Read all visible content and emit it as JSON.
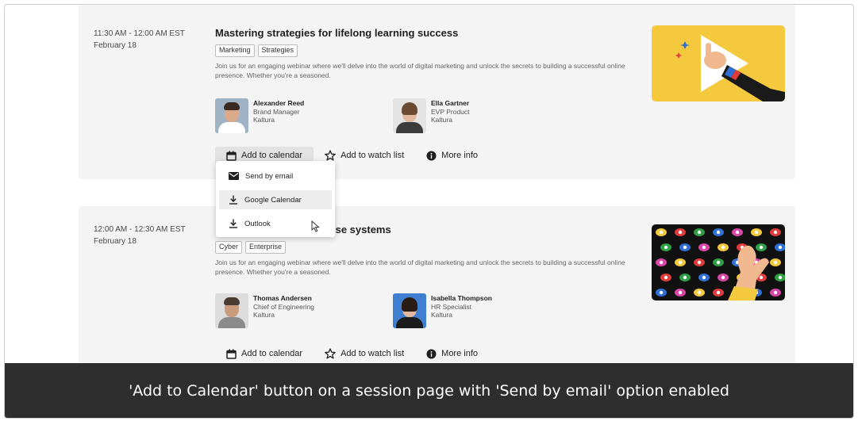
{
  "sessions": [
    {
      "time_range": "11:30 AM - 12:00 AM EST",
      "date": "February 18",
      "title": "Mastering strategies for lifelong learning success",
      "tags": [
        "Marketing",
        "Strategies"
      ],
      "description": "Join us for an engaging webinar where we'll delve into the world of digital marketing and unlock the secrets to building a successful online presence. Whether you're a seasoned.",
      "speakers": [
        {
          "name": "Alexander Reed",
          "role": "Brand Manager",
          "company": "Kaltura"
        },
        {
          "name": "Ella Gartner",
          "role": "EVP Product",
          "company": "Kaltura"
        }
      ],
      "actions": {
        "calendar": "Add to calendar",
        "watchlist": "Add to watch list",
        "info": "More info"
      }
    },
    {
      "time_range": "12:00 AM - 12:30 AM EST",
      "date": "February 18",
      "title": "ise systems",
      "tags": [
        "Cyber",
        "Enterprise"
      ],
      "description": "Join us for an engaging webinar where we'll delve into the world of digital marketing and unlock the secrets to building a successful online presence. Whether you're a seasoned.",
      "speakers": [
        {
          "name": "Thomas Andersen",
          "role": "Chief of Engineering",
          "company": "Kaltura"
        },
        {
          "name": "Isabella Thompson",
          "role": "HR Specialist",
          "company": "Kaltura"
        }
      ],
      "actions": {
        "calendar": "Add to calendar",
        "watchlist": "Add to watch list",
        "info": "More info"
      }
    }
  ],
  "calendar_menu": {
    "items": [
      {
        "label": "Send by email",
        "icon": "envelope-icon"
      },
      {
        "label": "Google Calendar",
        "icon": "download-icon"
      },
      {
        "label": "Outlook",
        "icon": "download-icon"
      }
    ],
    "hovered_item": "Google Calendar"
  },
  "caption": "'Add to Calendar' button on a session page with 'Send by email' option enabled",
  "colors": {
    "card_bg": "#f4f4f4",
    "thumb1_bg": "#f5c93e",
    "thumb2_bg": "#111111",
    "caption_bg": "#2e2e2e"
  }
}
